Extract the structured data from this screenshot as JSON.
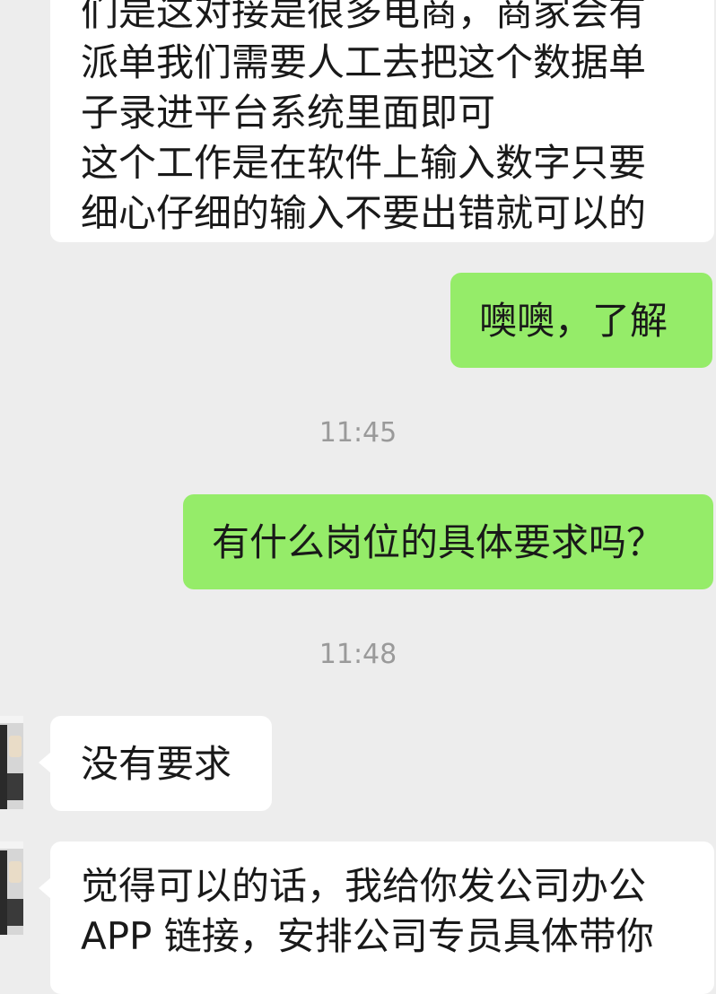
{
  "messages": {
    "m1": {
      "lines": [
        "们是这对接是很多电商，商家会有",
        "派单我们需要人工去把这个数据单",
        "子录进平台系统里面即可",
        "这个工作是在软件上输入数字只要",
        "细心仔细的输入不要出错就可以的"
      ]
    },
    "m2": {
      "text": "噢噢，了解"
    },
    "t1": "11:45",
    "m3": {
      "text": "有什么岗位的具体要求吗？"
    },
    "t2": "11:48",
    "m4": {
      "text": "没有要求"
    },
    "m5": {
      "lines": [
        "觉得可以的话，我给你发公司办公",
        "APP 链接，安排公司专员具体带你"
      ]
    }
  },
  "colors": {
    "background": "#ededed",
    "received_bubble": "#ffffff",
    "sent_bubble": "#95ec69",
    "timestamp": "#9a9a9a"
  }
}
